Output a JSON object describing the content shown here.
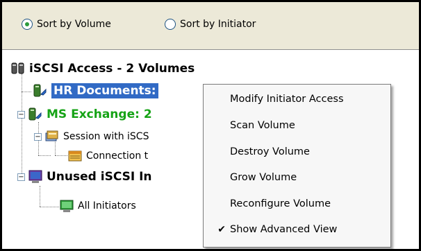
{
  "sort": {
    "by_volume_label": "Sort by Volume",
    "by_initiator_label": "Sort by Initiator",
    "selected": "volume"
  },
  "tree": {
    "root_label": "iSCSI Access - 2 Volumes",
    "hr_label": "HR Documents:",
    "ms_label": "MS Exchange: 2",
    "session_label": "Session with iSCS",
    "connection_label": "Connection t",
    "unused_label": "Unused iSCSI In",
    "all_initiators_label": "All Initiators"
  },
  "context_menu": {
    "items": [
      {
        "label": "Modify Initiator Access"
      },
      {
        "label": "Scan Volume"
      },
      {
        "label": "Destroy Volume"
      },
      {
        "label": "Grow Volume"
      },
      {
        "label": "Reconfigure Volume"
      },
      {
        "label": "Show Advanced View",
        "checked": true
      }
    ],
    "check_glyph": "✔"
  },
  "colors": {
    "selection": "#316ac5",
    "active_volume_text": "#16a316"
  },
  "icons": [
    "radio-icon",
    "iscsi-group-icon",
    "volume-icon",
    "session-icon",
    "connection-icon",
    "monitor-icon",
    "checkmark-icon"
  ]
}
